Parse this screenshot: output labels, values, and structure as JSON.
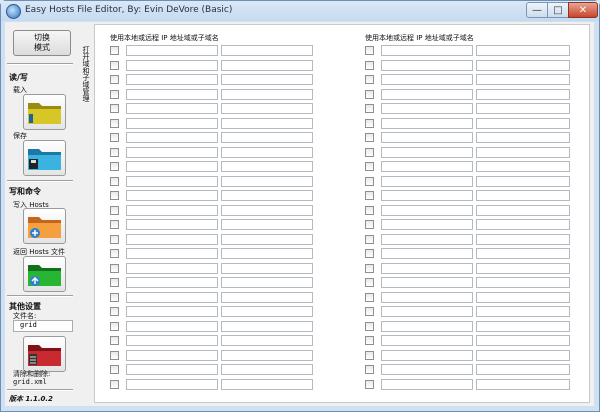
{
  "window": {
    "title": "Easy Hosts File Editor, By: Evin DeVore (Basic)",
    "min_glyph": "—",
    "max_glyph": "□",
    "close_glyph": "✕"
  },
  "sidebar": {
    "mode_button_line1": "切换",
    "mode_button_line2": "模式",
    "read_write_title": "读/写",
    "load_label": "载入",
    "save_label": "保存",
    "write_cmd_title": "写和命令",
    "write_hosts_label": "写入 Hosts",
    "restore_hosts_label": "返回 Hosts 文件",
    "other_settings_title": "其他设置",
    "filename_label": "文件名:",
    "filename_value": "grid",
    "clear_delete_label": "清除和删除:",
    "clear_delete_file": "grid.xml",
    "version": "版本 1.1.0.2"
  },
  "tab": {
    "label": "打开域和子域管理"
  },
  "columns": {
    "left_header": "使用本地或远程 IP 地址域或子域名",
    "right_header": "使用本地或远程 IP 地址域或子域名"
  },
  "colors": {
    "load_folder": "#c9b81a",
    "save_folder": "#2a9fd0",
    "write_folder": "#f08a25",
    "restore_folder": "#1e9a2a",
    "clear_folder": "#b41e24"
  }
}
